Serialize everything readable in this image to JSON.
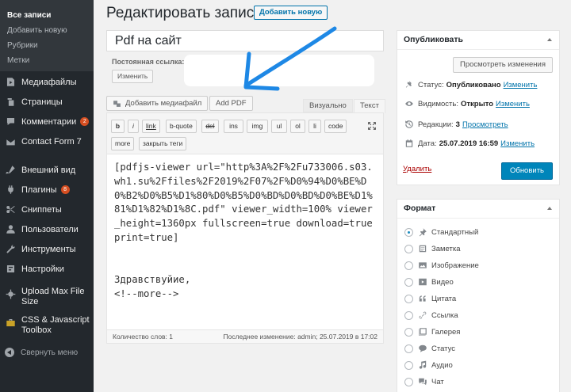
{
  "sidebar": {
    "submenu": [
      {
        "label": "Все записи",
        "current": true
      },
      {
        "label": "Добавить новую",
        "current": false
      },
      {
        "label": "Рубрики",
        "current": false
      },
      {
        "label": "Метки",
        "current": false
      }
    ],
    "menu": [
      {
        "label": "Медиафайлы",
        "icon": "media-icon"
      },
      {
        "label": "Страницы",
        "icon": "pages-icon"
      },
      {
        "label": "Комментарии",
        "icon": "comments-icon",
        "badge": "2"
      },
      {
        "label": "Contact Form 7",
        "icon": "mail-icon"
      },
      {
        "label": "Внешний вид",
        "icon": "appearance-icon"
      },
      {
        "label": "Плагины",
        "icon": "plugins-icon",
        "badge": "8"
      },
      {
        "label": "Сниппеты",
        "icon": "snippets-icon"
      },
      {
        "label": "Пользователи",
        "icon": "users-icon"
      },
      {
        "label": "Инструменты",
        "icon": "tools-icon"
      },
      {
        "label": "Настройки",
        "icon": "settings-icon"
      },
      {
        "label": "Upload Max File Size",
        "icon": "upload-gear-icon"
      },
      {
        "label": "CSS & Javascript Toolbox",
        "icon": "toolbox-icon"
      }
    ],
    "collapse_label": "Свернуть меню"
  },
  "header": {
    "title": "Редактировать запись",
    "add_new_label": "Добавить новую"
  },
  "post": {
    "title": "Pdf на сайт",
    "permalink_label": "Постоянная ссылка:",
    "change_label": "Изменить"
  },
  "editor": {
    "add_media_label": "Добавить медиафайл",
    "add_pdf_label": "Add PDF",
    "tab_visual": "Визуально",
    "tab_text": "Текст",
    "quicktags": [
      "b",
      "i",
      "link",
      "b-quote",
      "del",
      "ins",
      "img",
      "ul",
      "ol",
      "li",
      "code",
      "more",
      "закрыть теги"
    ],
    "content": "[pdfjs-viewer url=\"http%3A%2F%2Fu733006.s03.wh1.su%2Ffiles%2F2019%2F07%2F%D0%94%D0%BE%D0%B2%D0%B5%D1%80%D0%B5%D0%BD%D0%BD%D0%BE%D1%81%D1%82%D1%8C.pdf\" viewer_width=100% viewer_height=1360px fullscreen=true download=true print=true]\n\n\nЗдравствуйие,\n<!--more-->",
    "word_count": "Количество слов: 1",
    "last_edit": "Последнее изменение: admin; 25.07.2019 в 17:02"
  },
  "publish": {
    "title": "Опубликовать",
    "preview_label": "Просмотреть изменения",
    "status_label": "Статус:",
    "status_value": "Опубликовано",
    "visibility_label": "Видимость:",
    "visibility_value": "Открыто",
    "revisions_label": "Редакции:",
    "revisions_value": "3",
    "revisions_link": "Просмотреть",
    "date_label": "Дата:",
    "date_value": "25.07.2019 16:59",
    "edit_link": "Изменить",
    "delete_label": "Удалить",
    "update_label": "Обновить"
  },
  "format": {
    "title": "Формат",
    "selected": "Стандартный",
    "options": [
      {
        "label": "Стандартный",
        "icon": "pin-icon"
      },
      {
        "label": "Заметка",
        "icon": "aside-icon"
      },
      {
        "label": "Изображение",
        "icon": "image-icon"
      },
      {
        "label": "Видео",
        "icon": "video-icon"
      },
      {
        "label": "Цитата",
        "icon": "quote-icon"
      },
      {
        "label": "Ссылка",
        "icon": "link-icon"
      },
      {
        "label": "Галерея",
        "icon": "gallery-icon"
      },
      {
        "label": "Статус",
        "icon": "status-icon"
      },
      {
        "label": "Аудио",
        "icon": "audio-icon"
      },
      {
        "label": "Чат",
        "icon": "chat-icon"
      }
    ]
  },
  "colors": {
    "sidebar_bg": "#23282d",
    "link": "#0073aa",
    "primary_button": "#0085ba",
    "delete": "#aa0000",
    "annotation_arrow": "#1e88e5",
    "badge": "#d54e21"
  }
}
